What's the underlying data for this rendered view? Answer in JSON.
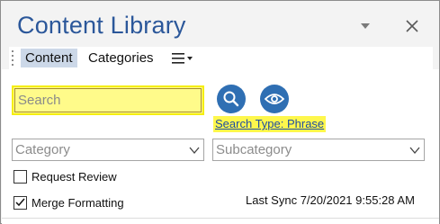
{
  "window": {
    "title": "Content Library",
    "dropdown_icon": "caret-down-icon",
    "close_icon": "close-icon"
  },
  "tabs": [
    {
      "label": "Content",
      "active": true
    },
    {
      "label": "Categories",
      "active": false
    }
  ],
  "menu": {
    "icon": "hamburger-menu-icon"
  },
  "search": {
    "value": "",
    "placeholder": "Search",
    "highlight_color": "#fef98d",
    "search_button_icon": "magnifier-icon",
    "preview_button_icon": "eye-icon",
    "search_type_label": "Search Type: Phrase"
  },
  "filters": {
    "category": {
      "placeholder": "Category",
      "value": ""
    },
    "subcategory": {
      "placeholder": "Subcategory",
      "value": ""
    }
  },
  "options": {
    "request_review": {
      "label": "Request Review",
      "checked": false
    },
    "merge_formatting": {
      "label": "Merge Formatting",
      "checked": true
    }
  },
  "status": {
    "last_sync": "Last Sync 7/20/2021 9:55:28 AM"
  },
  "colors": {
    "accent": "#2b579a",
    "button_blue": "#2f6fb3",
    "tab_active": "#ccd8e8",
    "highlight_yellow": "#fef74c"
  }
}
